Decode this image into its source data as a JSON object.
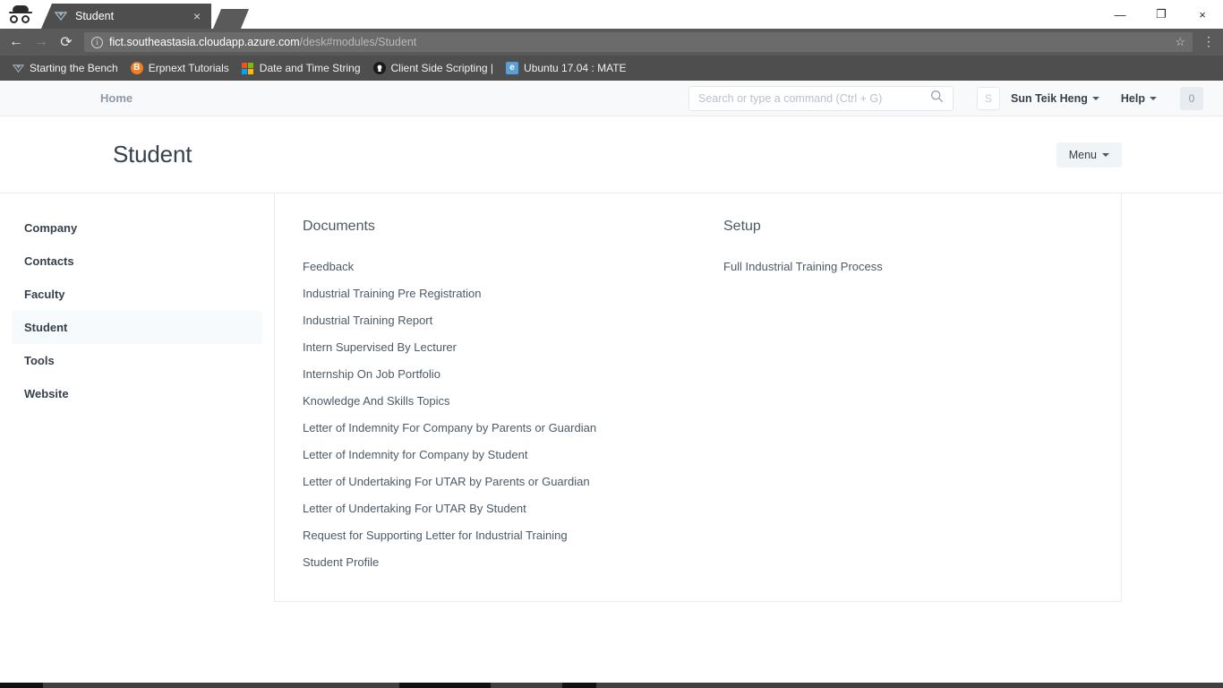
{
  "browser": {
    "incognito_icon": "incognito-icon",
    "tab": {
      "title": "Student",
      "favicon": "frappe-logo-icon",
      "close_label": "×"
    },
    "new_tab_label": "+",
    "window_controls": {
      "minimize": "—",
      "maximize": "❐",
      "close": "×"
    },
    "toolbar": {
      "back": "←",
      "forward": "→",
      "reload": "⟳",
      "info_icon": "i",
      "url_host": "fict.southeastasia.cloudapp.azure.com",
      "url_path": "/desk#modules/Student",
      "bookmark_star": "☆",
      "menu": "⋮"
    },
    "bookmarks": [
      {
        "label": "Starting the Bench",
        "icon": "frappe-logo-icon",
        "icon_bg": "transparent",
        "icon_color": "#9aa6b2",
        "glyph": "◢"
      },
      {
        "label": "Erpnext Tutorials",
        "icon": "blogger-icon",
        "icon_bg": "#f57c20",
        "icon_color": "#ffffff",
        "glyph": "B"
      },
      {
        "label": "Date and Time String",
        "icon": "microsoft-icon",
        "icon_bg": "transparent",
        "icon_color": "#ffffff",
        "glyph": ""
      },
      {
        "label": "Client Side Scripting |",
        "icon": "github-icon",
        "icon_bg": "#1b1b1b",
        "icon_color": "#ffffff",
        "glyph": "●"
      },
      {
        "label": "Ubuntu 17.04 : MATE",
        "icon": "ie-icon",
        "icon_bg": "#5aa0d8",
        "icon_color": "#ffffff",
        "glyph": "e"
      }
    ]
  },
  "app": {
    "navbar": {
      "home_label": "Home",
      "search_placeholder": "Search or type a command (Ctrl + G)",
      "search_value": "",
      "search_icon": "search-icon",
      "avatar_initial": "S",
      "user_name": "Sun Teik Heng",
      "help_label": "Help",
      "notification_count": "0"
    },
    "page": {
      "title": "Student",
      "menu_label": "Menu"
    },
    "sidebar": {
      "items": [
        {
          "label": "Company",
          "active": false
        },
        {
          "label": "Contacts",
          "active": false
        },
        {
          "label": "Faculty",
          "active": false
        },
        {
          "label": "Student",
          "active": true
        },
        {
          "label": "Tools",
          "active": false
        },
        {
          "label": "Website",
          "active": false
        }
      ]
    },
    "sections": [
      {
        "title": "Documents",
        "links": [
          "Feedback",
          "Industrial Training Pre Registration",
          "Industrial Training Report",
          "Intern Supervised By Lecturer",
          "Internship On Job Portfolio",
          "Knowledge And Skills Topics",
          "Letter of Indemnity For Company by Parents or Guardian",
          "Letter of Indemnity for Company by Student",
          "Letter of Undertaking For UTAR by Parents or Guardian",
          "Letter of Undertaking For UTAR By Student",
          "Request for Supporting Letter for Industrial Training",
          "Student Profile"
        ]
      },
      {
        "title": "Setup",
        "links": [
          "Full Industrial Training Process"
        ]
      }
    ]
  },
  "colors": {
    "chrome_dark": "#5a5a5a",
    "chrome_tabstrip": "#4e4e4e",
    "app_text": "#36414c",
    "link_text": "#4c5a67",
    "muted": "#8d99a6",
    "border": "#e8ecf0",
    "active_bg": "#f7fafc"
  }
}
